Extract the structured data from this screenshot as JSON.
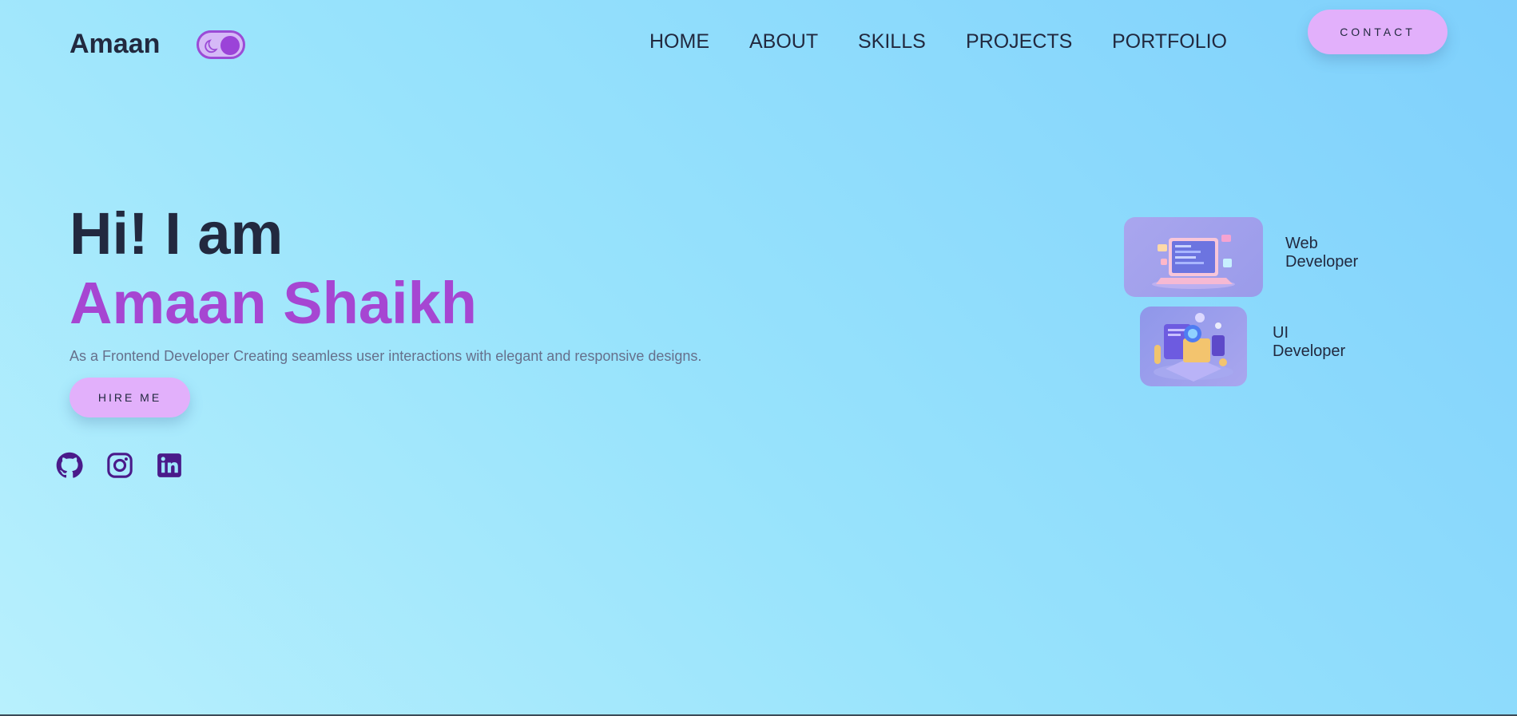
{
  "header": {
    "logo": "Amaan",
    "theme_toggle_icon": "moon-icon",
    "nav": [
      "HOME",
      "ABOUT",
      "SKILLS",
      "PROJECTS",
      "PORTFOLIO"
    ],
    "contact_label": "CONTACT"
  },
  "hero": {
    "greeting": "Hi! I am",
    "name": "Amaan Shaikh",
    "description": "As a Frontend Developer Creating seamless user interactions with elegant and responsive designs.",
    "hire_label": "HIRE ME"
  },
  "social": [
    {
      "icon": "github-icon"
    },
    {
      "icon": "instagram-icon"
    },
    {
      "icon": "linkedin-icon"
    }
  ],
  "services": [
    {
      "line1": "Web",
      "line2": "Developer",
      "icon": "laptop-illustration"
    },
    {
      "line1": "UI",
      "line2": "Developer",
      "icon": "ui-design-illustration"
    }
  ],
  "colors": {
    "text": "#22293f",
    "accent": "#a646d2",
    "button": "#e2b0fb",
    "social": "#4a1a8a"
  }
}
